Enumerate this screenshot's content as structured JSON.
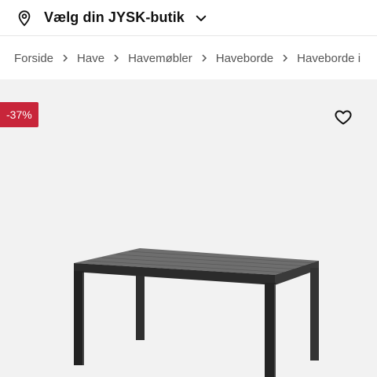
{
  "store_selector": {
    "label": "Vælg din JYSK-butik",
    "pin_icon": "location-pin-icon",
    "chevron_icon": "chevron-down-icon"
  },
  "breadcrumb": {
    "items": [
      "Forside",
      "Have",
      "Havemøbler",
      "Haveborde",
      "Haveborde i"
    ]
  },
  "product": {
    "discount_badge": "-37%",
    "favorite_icon": "heart-icon",
    "image_alt": "garden-table-image"
  },
  "colors": {
    "badge": "#c8253a",
    "image_background": "#f2f2f2"
  }
}
